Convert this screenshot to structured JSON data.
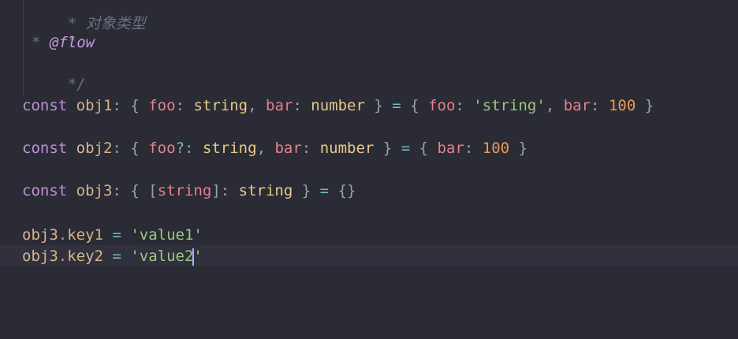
{
  "comment": {
    "line1": "* 对象类型",
    "line2": "*",
    "line3_star": "* ",
    "line3_tag": "@flow",
    "line4": "*/"
  },
  "code": {
    "l1": {
      "kw": "const",
      "name": "obj1",
      "p1": "foo",
      "t1": "string",
      "p2": "bar",
      "t2": "number",
      "v_p1": "foo",
      "v_s1": "'string'",
      "v_p2": "bar",
      "v_n2": "100"
    },
    "l2": {
      "kw": "const",
      "name": "obj2",
      "p1": "foo",
      "opt": "?",
      "t1": "string",
      "p2": "bar",
      "t2": "number",
      "v_p1": "bar",
      "v_n1": "100"
    },
    "l3": {
      "kw": "const",
      "name": "obj3",
      "key_t": "string",
      "val_t": "string",
      "init": "{}"
    },
    "l4": {
      "obj": "obj3",
      "key": "key1",
      "val": "'value1'"
    },
    "l5": {
      "obj": "obj3",
      "key": "key2",
      "val_before": "'value2",
      "val_after": "'"
    }
  }
}
